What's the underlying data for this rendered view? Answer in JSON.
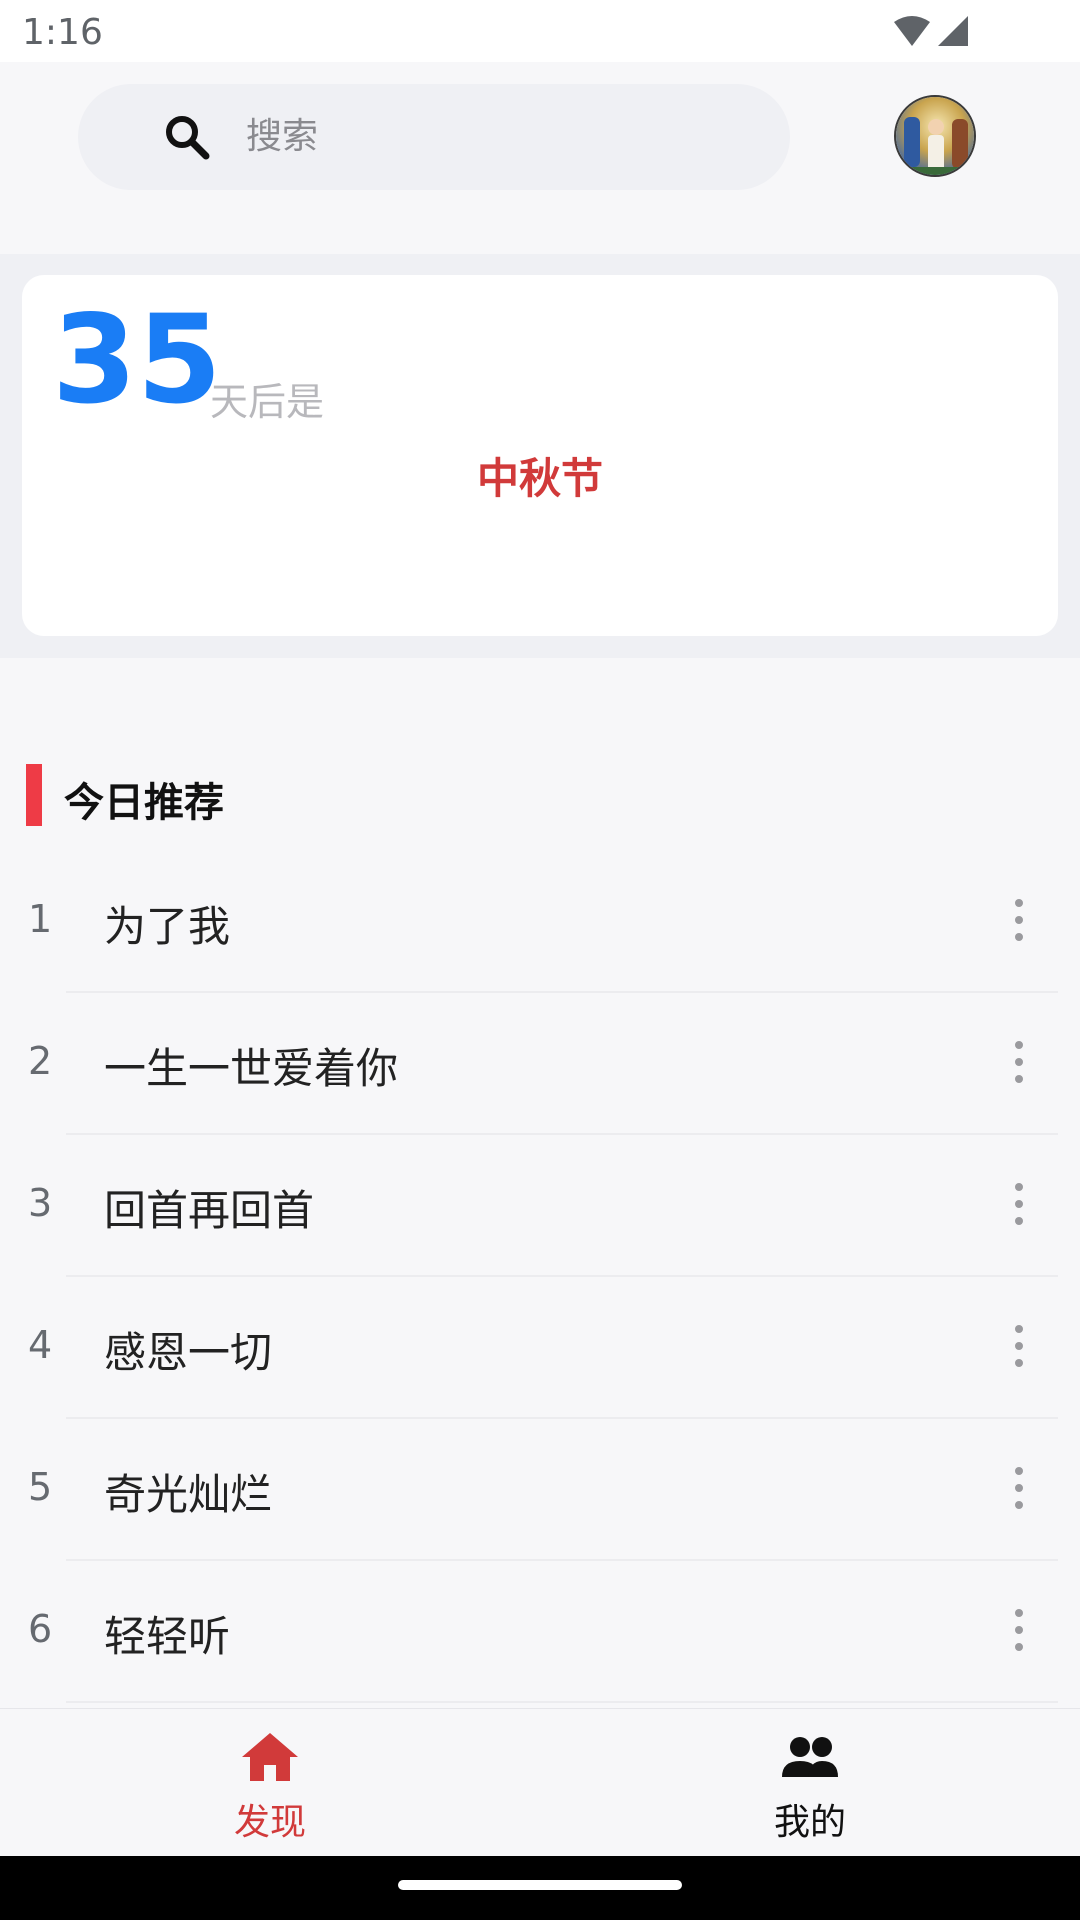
{
  "status_bar": {
    "time": "1:16",
    "icons": [
      "wifi-icon",
      "signal-icon"
    ]
  },
  "search": {
    "placeholder": "搜索",
    "icon": "search-icon"
  },
  "avatar": {
    "icon": "profile-avatar"
  },
  "countdown": {
    "days": "35",
    "suffix": "天后是",
    "holiday": "中秋节",
    "days_color": "#1a7df5",
    "holiday_color": "#d13a3a"
  },
  "recommend": {
    "title": "今日推荐",
    "accent_color": "#ee3b46",
    "songs": [
      {
        "index": "1",
        "title": "为了我"
      },
      {
        "index": "2",
        "title": "一生一世爱着你"
      },
      {
        "index": "3",
        "title": "回首再回首"
      },
      {
        "index": "4",
        "title": "感恩一切"
      },
      {
        "index": "5",
        "title": "奇光灿烂"
      },
      {
        "index": "6",
        "title": "轻轻听"
      }
    ]
  },
  "bottom_nav": {
    "items": [
      {
        "label": "发现",
        "icon": "home-icon",
        "active": true,
        "color": "#d13a3a"
      },
      {
        "label": "我的",
        "icon": "people-icon",
        "active": false,
        "color": "#111111"
      }
    ]
  }
}
